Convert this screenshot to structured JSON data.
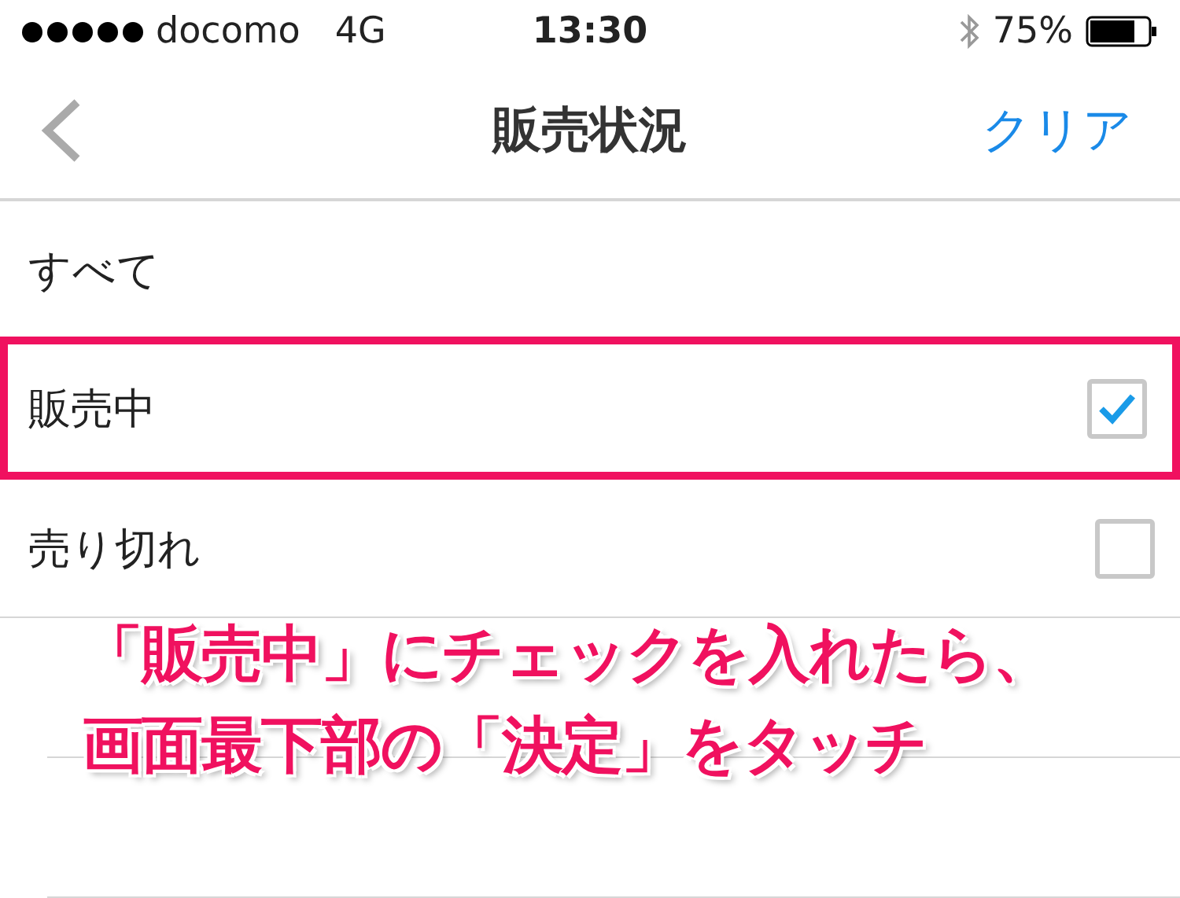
{
  "status_bar": {
    "carrier": "docomo",
    "network": "4G",
    "time": "13:30",
    "battery": "75%"
  },
  "nav": {
    "title": "販売状況",
    "action": "クリア"
  },
  "options": [
    {
      "label": "すべて",
      "kind": "plain",
      "highlighted": false
    },
    {
      "label": "販売中",
      "kind": "checkbox",
      "checked": true,
      "highlighted": true
    },
    {
      "label": "売り切れ",
      "kind": "checkbox",
      "checked": false,
      "highlighted": false
    }
  ],
  "annotation": {
    "lines": [
      "「販売中」にチェックを入れたら、",
      "画面最下部の「決定」をタッチ"
    ]
  }
}
